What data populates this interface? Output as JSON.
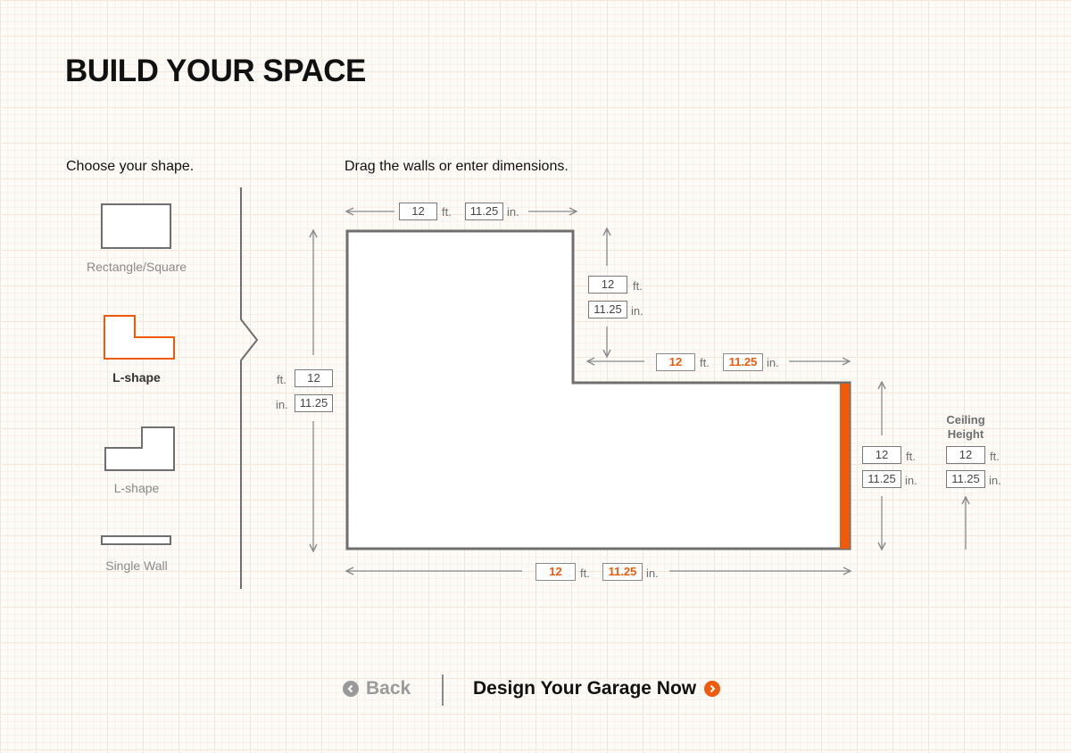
{
  "page": {
    "title": "BUILD YOUR SPACE",
    "shape_prompt": "Choose your shape.",
    "drag_prompt": "Drag the walls or enter dimensions."
  },
  "shapes": [
    {
      "label": "Rectangle/Square",
      "selected": false
    },
    {
      "label": "L-shape",
      "selected": true
    },
    {
      "label": "L-shape",
      "selected": false
    },
    {
      "label": "Single Wall",
      "selected": false
    }
  ],
  "units": {
    "ft": "ft.",
    "in": "in."
  },
  "dimensions": {
    "top": {
      "ft": "12",
      "in": "11.25"
    },
    "inner_vertical": {
      "ft": "12",
      "in": "11.25"
    },
    "inner_horizontal": {
      "ft": "12",
      "in": "11.25"
    },
    "left": {
      "ft": "12",
      "in": "11.25"
    },
    "right": {
      "ft": "12",
      "in": "11.25"
    },
    "bottom": {
      "ft": "12",
      "in": "11.25"
    },
    "ceiling": {
      "label_line1": "Ceiling",
      "label_line2": "Height",
      "ft": "12",
      "in": "11.25"
    }
  },
  "nav": {
    "back": "Back",
    "next": "Design Your Garage Now"
  },
  "colors": {
    "accent": "#ef5b0c",
    "wall": "#6f6f6f",
    "arrow": "#8a8a8a"
  }
}
